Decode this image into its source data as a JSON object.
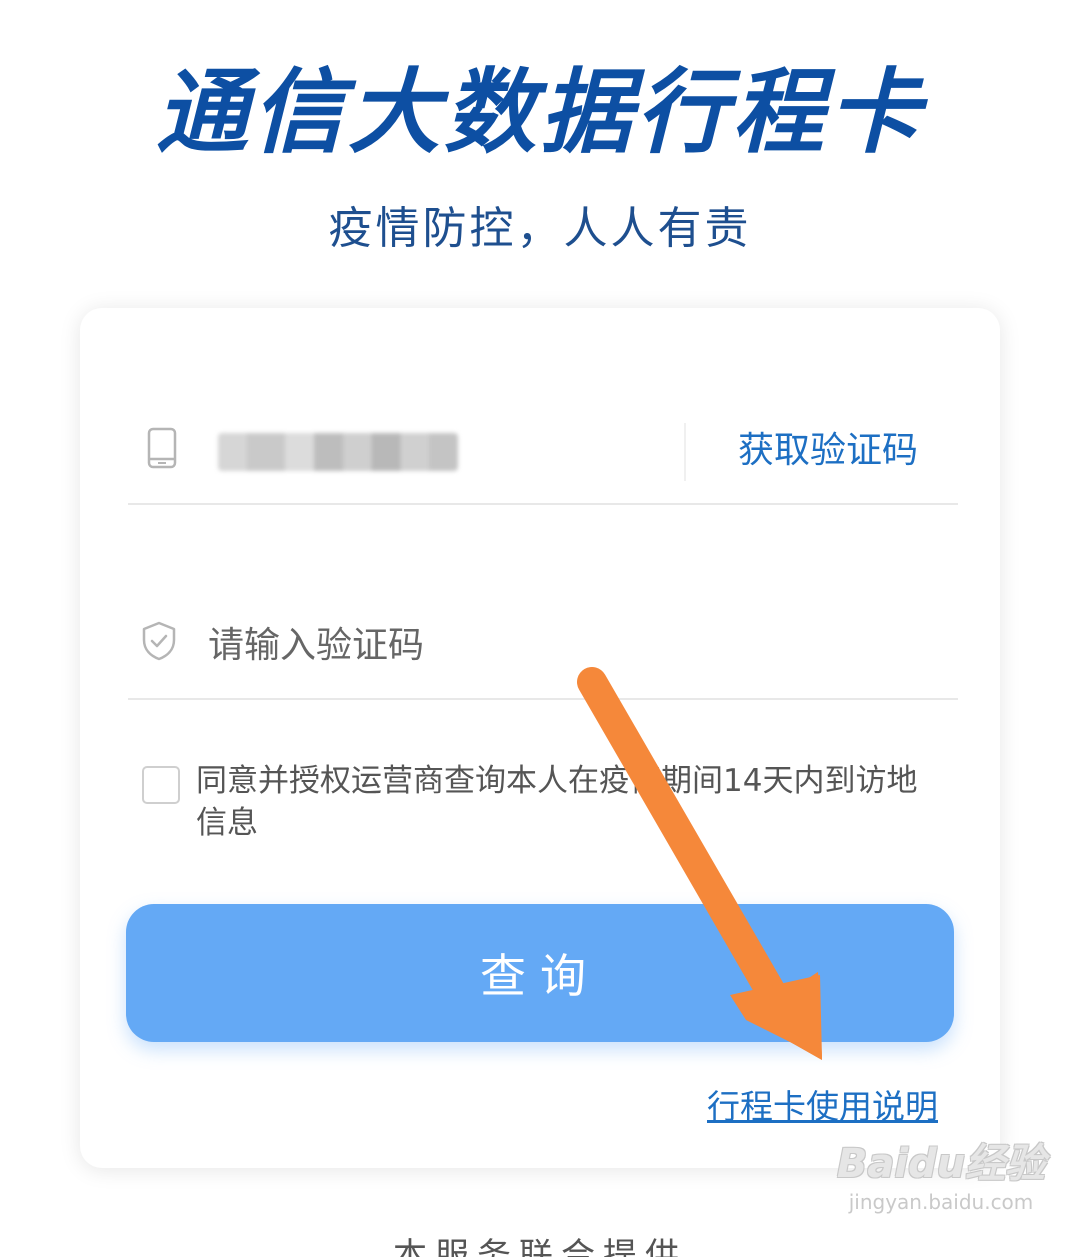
{
  "header": {
    "title": "通信大数据行程卡",
    "subtitle": "疫情防控，人人有责"
  },
  "form": {
    "phone_icon": "phone-icon",
    "get_code_label": "获取验证码",
    "code_icon": "shield-icon",
    "code_placeholder": "请输入验证码",
    "agree_text": "同意并授权运营商查询本人在疫情期间14天内到访地信息",
    "agree_checked": false,
    "query_label": "查询",
    "guide_link": "行程卡使用说明"
  },
  "overlay": {
    "arrow_color": "#f5883a"
  },
  "watermark": {
    "logo": "Baidu经验",
    "url": "jingyan.baidu.com"
  },
  "footer": {
    "partial_text": "本服务联合提供"
  },
  "colors": {
    "title": "#0d4fa3",
    "link": "#1d6fc3",
    "button": "#64a9f5"
  }
}
